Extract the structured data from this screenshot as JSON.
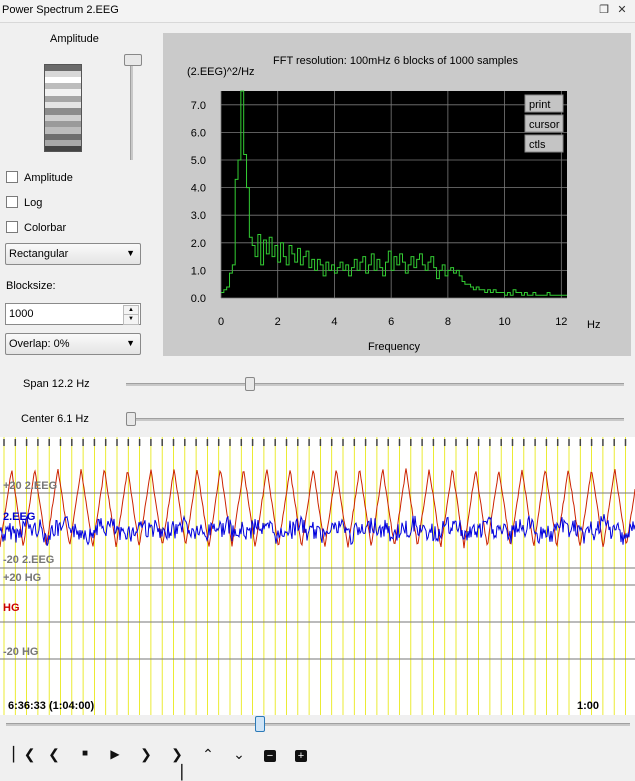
{
  "window": {
    "title": "Power Spectrum 2.EEG",
    "icons": [
      "restore-icon",
      "close-icon"
    ]
  },
  "controls": {
    "amplitude_label": "Amplitude",
    "checkboxes": [
      {
        "label": "Amplitude",
        "checked": false
      },
      {
        "label": "Log",
        "checked": false
      },
      {
        "label": "Colorbar",
        "checked": false
      }
    ],
    "window_type": "Rectangular",
    "blocksize_label": "Blocksize:",
    "blocksize_value": "1000",
    "overlap": "Overlap: 0%",
    "span_label": "Span 12.2 Hz",
    "span_value_hz": 12.2,
    "center_label": "Center 6.1 Hz",
    "center_value_hz": 6.1
  },
  "spectrum": {
    "header": "FFT resolution: 100mHz   6 blocks of 1000 samples",
    "ylabel": "(2.EEG)^2/Hz",
    "xlabel": "Frequency",
    "xunit": "Hz",
    "buttons": [
      "print",
      "cursor",
      "ctls"
    ],
    "line_color": "#33cc33",
    "background": "#000000"
  },
  "chart_data": {
    "type": "line",
    "title": "",
    "xlabel": "Frequency",
    "ylabel": "(2.EEG)^2/Hz",
    "xlim": [
      0,
      12.2
    ],
    "ylim": [
      0,
      7.5
    ],
    "x_ticks": [
      0,
      2,
      4,
      6,
      8,
      10,
      12
    ],
    "y_ticks": [
      0.0,
      1.0,
      2.0,
      3.0,
      4.0,
      5.0,
      6.0,
      7.0
    ],
    "grid": true,
    "series": [
      {
        "step": 0.1,
        "values": [
          0.2,
          0.3,
          0.4,
          0.9,
          1.2,
          4.3,
          5.0,
          7.5,
          5.2,
          4.0,
          2.2,
          1.9,
          1.5,
          2.3,
          1.2,
          2.1,
          1.6,
          2.2,
          1.5,
          1.9,
          1.3,
          2.0,
          1.5,
          1.2,
          1.9,
          1.6,
          1.3,
          1.8,
          1.2,
          1.5,
          1.7,
          1.1,
          1.4,
          1.0,
          1.4,
          1.2,
          0.8,
          1.3,
          1.0,
          1.2,
          0.9,
          1.1,
          1.3,
          1.0,
          1.2,
          0.8,
          1.1,
          1.4,
          1.0,
          1.3,
          1.5,
          0.9,
          1.2,
          1.6,
          1.0,
          1.4,
          1.1,
          0.8,
          1.3,
          1.7,
          1.0,
          1.5,
          1.2,
          1.6,
          1.3,
          0.9,
          1.2,
          1.5,
          1.1,
          1.4,
          1.6,
          1.2,
          1.0,
          1.3,
          1.5,
          1.1,
          0.7,
          1.0,
          1.2,
          0.8,
          1.0,
          1.1,
          0.9,
          1.0,
          0.8,
          0.6,
          0.5,
          0.5,
          0.4,
          0.3,
          0.4,
          0.3,
          0.3,
          0.2,
          0.3,
          0.2,
          0.3,
          0.2,
          0.2,
          0.2,
          0.1,
          0.2,
          0.1,
          0.3,
          0.2,
          0.2,
          0.1,
          0.2,
          0.1,
          0.1,
          0.2,
          0.1,
          0.1,
          0.1,
          0.1,
          0.2,
          0.1,
          0.1,
          0.1,
          0.1,
          0.1,
          0.1,
          0.1
        ]
      }
    ]
  },
  "eeg": {
    "channels": [
      {
        "top": "+20 2.EEG",
        "name": "2.EEG",
        "bottom": "-20 2.EEG",
        "name_color": "#0000cc"
      },
      {
        "top": "+20 HG",
        "name": "HG",
        "bottom": "-20 HG",
        "name_color": "#cc0000"
      }
    ],
    "time_left": "6:36:33 (1:04:00)",
    "time_right": "1:00",
    "trace_colors": {
      "eeg": "#0000dd",
      "hg": "#cc2200",
      "markers": "#e6e600"
    },
    "scroll_position": 0.41
  },
  "nav": {
    "buttons": [
      "skip-first-icon",
      "prev-icon",
      "stop-icon",
      "play-icon",
      "next-icon",
      "skip-last-icon",
      "up-icon",
      "down-icon",
      "zoom-out-icon",
      "zoom-in-icon"
    ]
  }
}
